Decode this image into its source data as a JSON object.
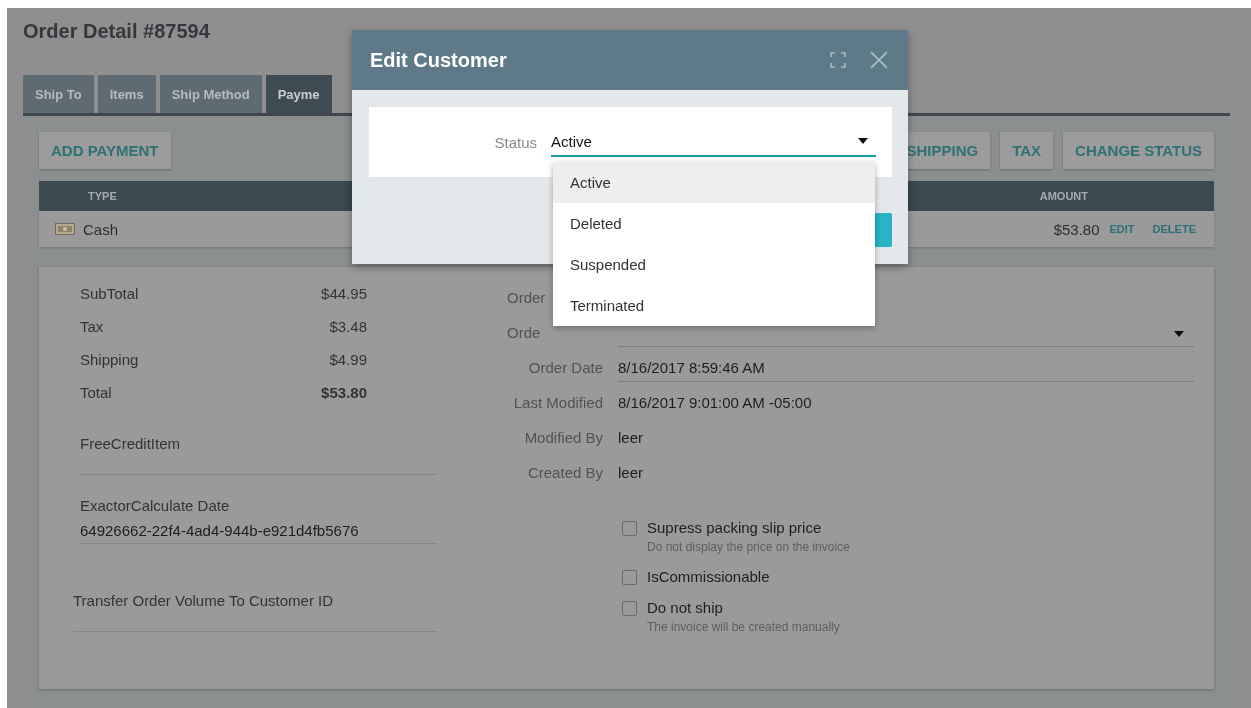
{
  "page": {
    "title": "Order Detail #87594"
  },
  "tabs": [
    {
      "label": "Ship To",
      "selected": false
    },
    {
      "label": "Items",
      "selected": false
    },
    {
      "label": "Ship Method",
      "selected": false
    },
    {
      "label": "Payme",
      "selected": true
    }
  ],
  "actions_left": [
    "ADD PAYMENT"
  ],
  "actions_right": [
    "SHIPPING",
    "TAX",
    "CHANGE STATUS"
  ],
  "payments": {
    "columns": [
      "TYPE",
      "AMOUNT"
    ],
    "rows": [
      {
        "type": "Cash",
        "amount": "$53.80",
        "actions": [
          "EDIT",
          "DELETE"
        ]
      }
    ]
  },
  "totals": [
    {
      "label": "SubTotal",
      "value": "$44.95",
      "bold": false
    },
    {
      "label": "Tax",
      "value": "$3.48",
      "bold": false
    },
    {
      "label": "Shipping",
      "value": "$4.99",
      "bold": false
    },
    {
      "label": "Total",
      "value": "$53.80",
      "bold": true
    }
  ],
  "fields_left": [
    {
      "label": "FreeCreditItem"
    },
    {
      "label": "ExactorCalculate Date",
      "value": "64926662-22f4-4ad4-944b-e921d4fb5676"
    },
    {
      "label": "Transfer Order Volume To Customer ID"
    }
  ],
  "fields_right": [
    {
      "label": "Order",
      "kind": "covered"
    },
    {
      "label": "Orde",
      "kind": "select"
    },
    {
      "label": "Order Date",
      "value": "8/16/2017 8:59:46 AM",
      "kind": "input"
    },
    {
      "label": "Last Modified",
      "value": "8/16/2017 9:01:00 AM -05:00",
      "kind": "text"
    },
    {
      "label": "Modified By",
      "value": "leer",
      "kind": "text"
    },
    {
      "label": "Created By",
      "value": "leer",
      "kind": "text"
    }
  ],
  "checkboxes": [
    {
      "label": "Supress packing slip price",
      "hint": "Do not display the price on the invoice",
      "checked": false
    },
    {
      "label": "IsCommissionable",
      "checked": false
    },
    {
      "label": "Do not ship",
      "hint": "The invoice will be created manually",
      "checked": false
    }
  ],
  "dialog": {
    "title": "Edit Customer",
    "field": {
      "label": "Status",
      "value": "Active"
    },
    "options": [
      {
        "label": "Active",
        "selected": true
      },
      {
        "label": "Deleted",
        "selected": false
      },
      {
        "label": "Suspended",
        "selected": false
      },
      {
        "label": "Terminated",
        "selected": false
      }
    ]
  }
}
